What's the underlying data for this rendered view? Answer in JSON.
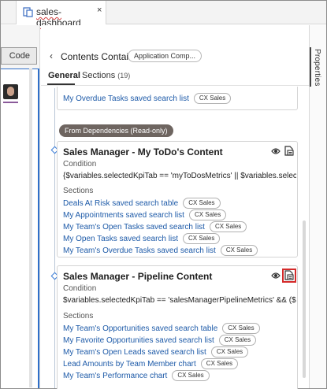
{
  "tab": {
    "label": "sales-dashboard",
    "close": "×"
  },
  "left": {
    "code_label": "Code"
  },
  "right_tab": {
    "label": "Properties"
  },
  "header": {
    "back": "‹",
    "title": "Contents Container",
    "chip": "Application Comp..."
  },
  "tabs": {
    "general": "General",
    "sections": "Sections",
    "sections_count": "(19)"
  },
  "top_card": {
    "link": "My Overdue Tasks saved search list",
    "chip": "CX Sales"
  },
  "dependencies_label": "From Dependencies (Read-only)",
  "cards": [
    {
      "title": "Sales Manager - My ToDo's Content",
      "condition_label": "Condition",
      "condition": "{$variables.selectedKpiTab == 'myToDosMetrics' || $variables.selectedKp...",
      "sections_label": "Sections",
      "sections": [
        {
          "name": "Deals At Risk saved search table",
          "chip": "CX Sales"
        },
        {
          "name": "My Appointments saved search list",
          "chip": "CX Sales"
        },
        {
          "name": "My Team's Open Tasks saved search list",
          "chip": "CX Sales"
        },
        {
          "name": "My Open Tasks saved search list",
          "chip": "CX Sales"
        },
        {
          "name": "My Team's Overdue Tasks saved search list",
          "chip": "CX Sales"
        }
      ]
    },
    {
      "title": "Sales Manager - Pipeline Content",
      "condition_label": "Condition",
      "condition": "$variables.selectedKpiTab == 'salesManagerPipelineMetrics' && ($applic...",
      "sections_label": "Sections",
      "sections": [
        {
          "name": "My Team's Opportunities saved search table",
          "chip": "CX Sales"
        },
        {
          "name": "My Favorite Opportunities saved search list",
          "chip": "CX Sales"
        },
        {
          "name": "My Team's Open Leads saved search list",
          "chip": "CX Sales"
        },
        {
          "name": "Lead Amounts by Team Member chart",
          "chip": "CX Sales"
        },
        {
          "name": "My Team's Performance chart",
          "chip": "CX Sales"
        }
      ]
    }
  ],
  "colors": {
    "link": "#1d5aa8",
    "highlight": "#d42a2a",
    "tree_node": "#3a7bd5"
  }
}
